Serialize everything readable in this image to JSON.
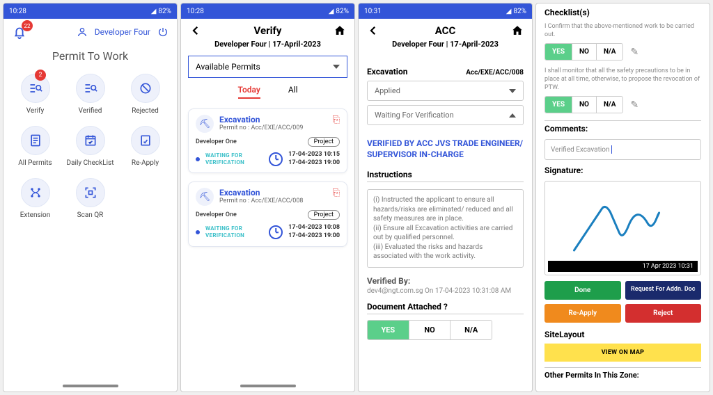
{
  "statusbar": {
    "time_a": "10:28",
    "time_b": "10:31",
    "battery": "82%"
  },
  "screen1": {
    "notif_count": "22",
    "user": "Developer Four",
    "title": "Permit To Work",
    "verify_badge": "2",
    "items": {
      "verify": "Verify",
      "verified": "Verified",
      "rejected": "Rejected",
      "all_permits": "All Permits",
      "daily": "Daily CheckList",
      "reapply": "Re-Apply",
      "extension": "Extension",
      "scanqr": "Scan QR"
    }
  },
  "screen2": {
    "title": "Verify",
    "subtitle": "Developer Four | 17-April-2023",
    "select_label": "Available Permits",
    "tabs": {
      "today": "Today",
      "all": "All"
    },
    "cards": [
      {
        "title": "Excavation",
        "permit_no_label": "Permit no :",
        "permit_no": "Acc/EXE/ACC/009",
        "dev": "Developer One",
        "project": "Project",
        "status": "WAITING FOR VERIFICATION",
        "t1": "17-04-2023 10:15",
        "t2": "17-04-2023 19:00"
      },
      {
        "title": "Excavation",
        "permit_no_label": "Permit no :",
        "permit_no": "Acc/EXE/ACC/008",
        "dev": "Developer One",
        "project": "Project",
        "status": "WAITING FOR VERIFICATION",
        "t1": "17-04-2023 10:08",
        "t2": "17-04-2023 19:00"
      }
    ]
  },
  "screen3": {
    "title": "ACC",
    "subtitle": "Developer Four | 17-April-2023",
    "type_label": "Excavation",
    "permit_no": "Acc/EXE/ACC/008",
    "status1": "Applied",
    "status2": "Waiting For Verification",
    "verified_title": "VERIFIED BY ACC JVS TRADE ENGINEER/ SUPERVISOR IN-CHARGE",
    "instructions_h": "Instructions",
    "instructions": "(i) Instructed the applicant to ensure all hazards/risks are eliminated/ reduced and all safety measures are in place.\n(ii) Ensure all Excavation activities are carried out by qualified personnel.\n(iii) Evaluated the risks and hazards associated with the work activity.",
    "verified_by_h": "Verified By:",
    "verified_by": "dev4@ngt.com.sg On 17-04-2023 10:31:08 AM",
    "doc_h": "Document Attached ?",
    "yes": "YES",
    "no": "NO",
    "na": "N/A"
  },
  "screen4": {
    "checklist_h": "Checklist(s)",
    "confirm1": "I Confirm that the above-mentioned work to be carried out.",
    "confirm2": "I shall monitor that all the safety precautions to be in place at all time, otherwise, to propose the revocation of PTW.",
    "yes": "YES",
    "no": "NO",
    "na": "N/A",
    "comments_h": "Comments:",
    "comment_val": "Verified Excavation",
    "signature_h": "Signature:",
    "sig_ts": "17 Apr 2023 10:31",
    "btn_done": "Done",
    "btn_req": "Request For Addn. Doc",
    "btn_reapply": "Re-Apply",
    "btn_reject": "Reject",
    "sitelayout": "SiteLayout",
    "mapbtn": "VIEW ON MAP",
    "other": "Other Permits In This Zone:"
  }
}
